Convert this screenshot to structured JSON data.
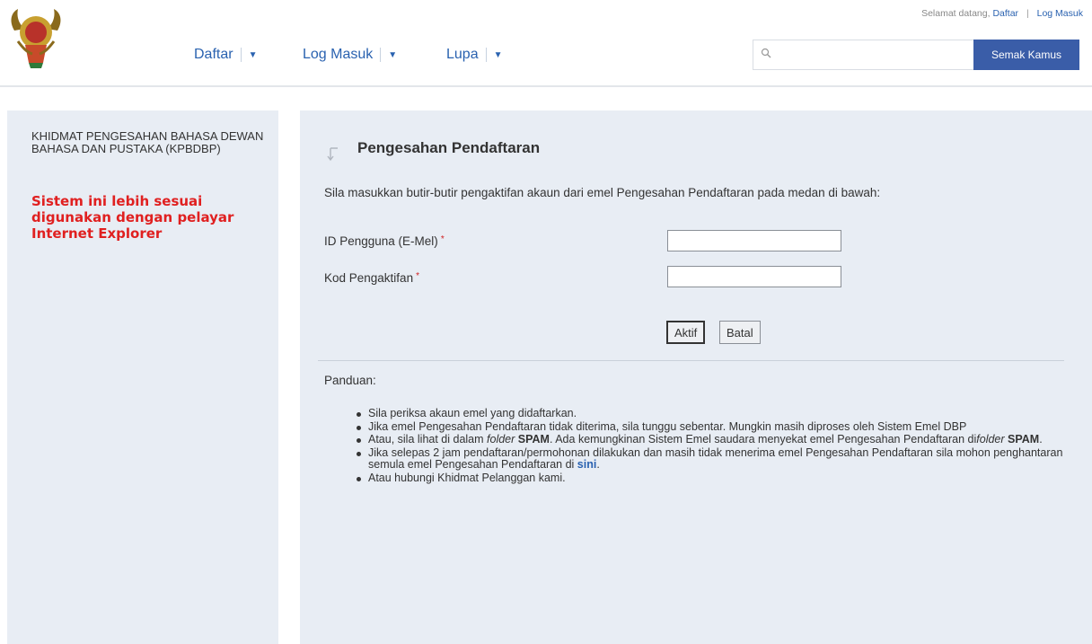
{
  "header": {
    "welcome_text": "Selamat datang,",
    "welcome_daftar": "Daftar",
    "welcome_sep": "|",
    "welcome_login": "Log Masuk",
    "nav": [
      {
        "label": "Daftar"
      },
      {
        "label": "Log Masuk"
      },
      {
        "label": "Lupa"
      }
    ],
    "search_placeholder": "",
    "search_button": "Semak Kamus"
  },
  "sidebar": {
    "title": "KHIDMAT PENGESAHAN BAHASA DEWAN BAHASA DAN PUSTAKA (KPBDBP)",
    "note": "Sistem ini lebih sesuai digunakan dengan pelayar Internet Explorer"
  },
  "main": {
    "title": "Pengesahan Pendaftaran",
    "intro": "Sila masukkan butir-butir pengaktifan akaun dari emel Pengesahan Pendaftaran pada medan di bawah:",
    "fields": [
      {
        "label": "ID Pengguna (E-Mel)",
        "value": ""
      },
      {
        "label": "Kod Pengaktifan",
        "value": ""
      }
    ],
    "required_mark": "*",
    "buttons": {
      "activate": "Aktif",
      "cancel": "Batal"
    },
    "guide_title": "Panduan:",
    "guide": {
      "item1": "Sila periksa akaun emel yang didaftarkan.",
      "item2": "Jika emel Pengesahan Pendaftaran tidak diterima, sila tunggu sebentar. Mungkin masih diproses oleh Sistem Emel DBP",
      "item3_a": "Atau, sila lihat di dalam ",
      "item3_b": "folder",
      "item3_c": " ",
      "item3_d": "SPAM",
      "item3_e": ". Ada kemungkinan Sistem Emel saudara menyekat emel Pengesahan Pendaftaran di",
      "item3_f": "folder",
      "item3_g": " ",
      "item3_h": "SPAM",
      "item3_i": ".",
      "item4_a": "Jika selepas 2 jam pendaftaran/permohonan dilakukan dan masih tidak menerima emel Pengesahan Pendaftaran sila mohon penghantaran semula emel Pengesahan Pendaftaran di ",
      "item4_link": "sini",
      "item4_b": ".",
      "item5": "Atau hubungi Khidmat Pelanggan kami."
    }
  },
  "colors": {
    "link": "#2a62b0",
    "panel": "#e8edf4",
    "button": "#3a5da8",
    "warning": "#e02020"
  }
}
